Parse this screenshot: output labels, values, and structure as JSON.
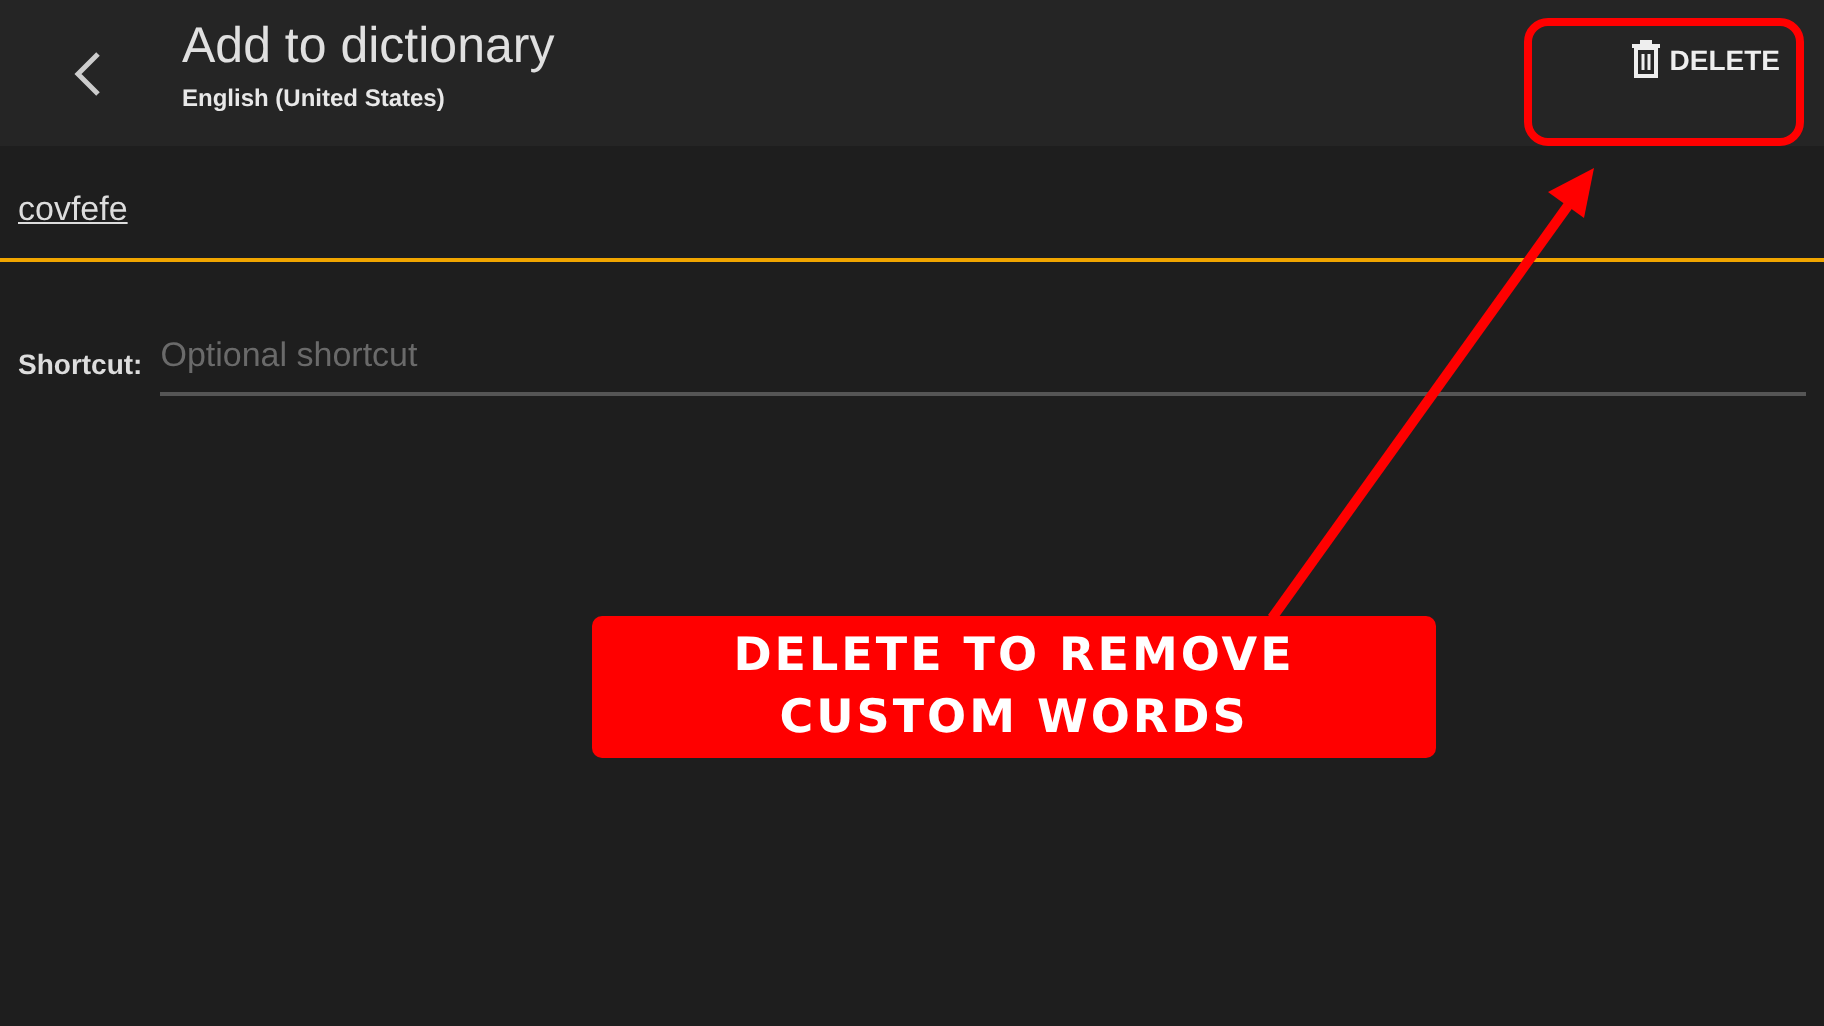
{
  "header": {
    "title": "Add to dictionary",
    "subtitle": "English (United States)",
    "delete_button": "DELETE"
  },
  "word_field": {
    "value": "covfefe"
  },
  "shortcut": {
    "label": "Shortcut:",
    "placeholder": "Optional shortcut"
  },
  "annotation": {
    "text": "DELETE TO REMOVE CUSTOM WORDS"
  }
}
